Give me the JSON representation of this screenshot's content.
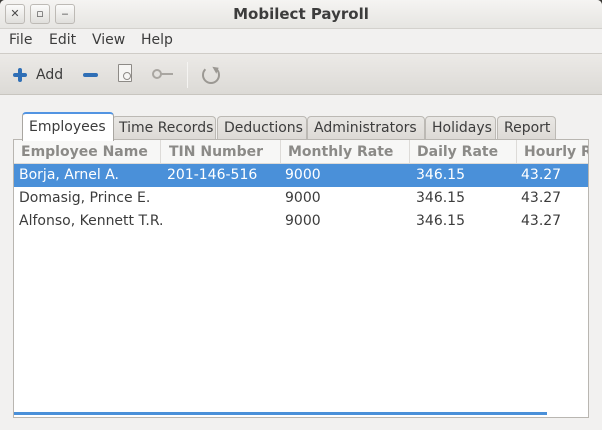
{
  "window": {
    "title": "Mobilect Payroll",
    "controls": {
      "close": "✕",
      "maximize": "▫",
      "minimize": "‒"
    }
  },
  "menu": [
    "File",
    "Edit",
    "View",
    "Help"
  ],
  "toolbar": {
    "add_label": "Add",
    "icons": [
      "plus-icon",
      "minus-icon",
      "document-search-icon",
      "key-icon",
      "refresh-icon"
    ]
  },
  "tabs": [
    "Employees",
    "Time Records",
    "Deductions",
    "Administrators",
    "Holidays",
    "Report"
  ],
  "active_tab": "Employees",
  "table": {
    "columns": [
      "Employee Name",
      "TIN Number",
      "Monthly Rate",
      "Daily Rate",
      "Hourly Rate"
    ],
    "rows": [
      [
        "Borja, Arnel A.",
        "201-146-516",
        "9000",
        "346.15",
        "43.27"
      ],
      [
        "Domasig, Prince E.",
        "",
        "9000",
        "346.15",
        "43.27"
      ],
      [
        "Alfonso, Kennett T.R.",
        "",
        "9000",
        "346.15",
        "43.27"
      ]
    ],
    "selected_row": 0
  },
  "colors": {
    "selection": "#4a90d9",
    "accent_icon": "#2f6fb6",
    "window_bg": "#f2f1f0"
  }
}
